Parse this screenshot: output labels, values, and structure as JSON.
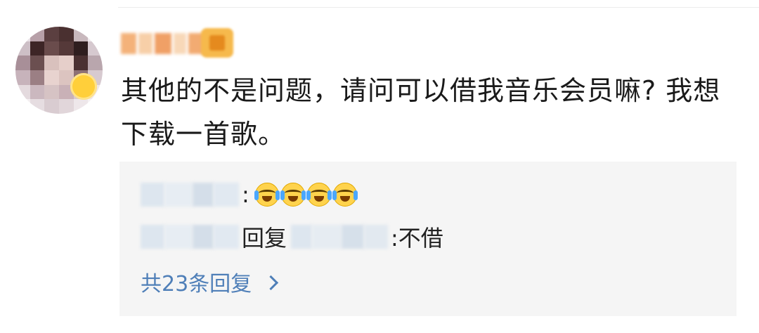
{
  "comment": {
    "text": "其他的不是问题，请问可以借我音乐会员嘛? 我想下载一首歌。"
  },
  "replies": [
    {
      "separator": ":",
      "emoji": [
        "crying-laughing",
        "crying-laughing",
        "crying-laughing",
        "crying-laughing"
      ]
    },
    {
      "reply_word": "回复",
      "text": ":不借"
    }
  ],
  "more_replies": {
    "label": "共23条回复"
  },
  "colors": {
    "link": "#4f7fb8",
    "reply_box_bg": "#f5f5f5",
    "text": "#1a1a1a"
  },
  "icons": {
    "more_arrow": "chevron-right-icon",
    "emoji": "crying-laughing-emoji"
  }
}
